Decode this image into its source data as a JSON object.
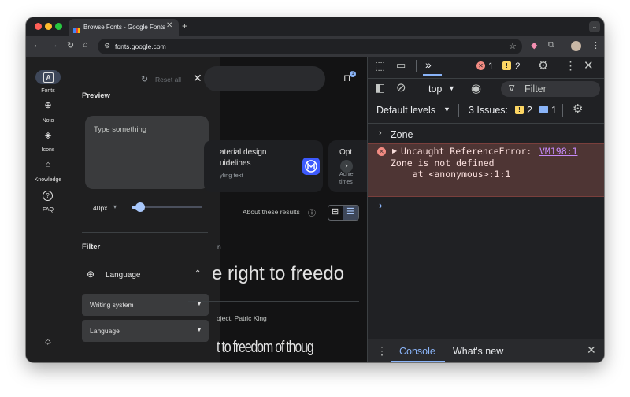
{
  "browser": {
    "tab_title": "Browse Fonts - Google Fonts",
    "url": "fonts.google.com",
    "new_tab_glyph": "+",
    "close_glyph": "✕"
  },
  "rail": {
    "items": [
      {
        "label": "Fonts",
        "icon": "font-icon",
        "glyph": "A"
      },
      {
        "label": "Noto",
        "icon": "globe-icon",
        "glyph": "⊕"
      },
      {
        "label": "Icons",
        "icon": "shapes-icon",
        "glyph": "◈"
      },
      {
        "label": "Knowledge",
        "icon": "school-icon",
        "glyph": "⌂"
      },
      {
        "label": "FAQ",
        "icon": "help-icon",
        "glyph": "?"
      }
    ]
  },
  "panel": {
    "reset_label": "Reset all",
    "preview_heading": "Preview",
    "textarea_placeholder": "Type something",
    "font_size_value": "40px",
    "font_size_level": 0.12,
    "filter_heading": "Filter",
    "language_heading": "Language",
    "writing_system_label": "Writing system",
    "language_select_label": "Language"
  },
  "content": {
    "card1_line1": "aterial design",
    "card1_line2": "uidelines",
    "card1_sub": "yling text",
    "card2_line1": "Opt",
    "card2_line2": "Achie",
    "card2_line3": "times",
    "about_results": "About these results",
    "breadcrumb_frag": "n",
    "sample_big": "e right to freedo",
    "designers": "oject, Patric King",
    "sample_condensed": "t to freedom of thoug",
    "bag_count": "1"
  },
  "devtools": {
    "error_count": "1",
    "warning_count": "2",
    "context_select": "top",
    "filter_placeholder": "Filter",
    "levels_label": "Default levels",
    "issues_label": "3 Issues:",
    "issues_warn_count": "2",
    "issues_info_count": "1",
    "console_lines": [
      {
        "text": "Zone"
      },
      {
        "title": "Uncaught ReferenceError:",
        "link": "VM198:1",
        "detail1": "Zone is not defined",
        "detail2": "    at <anonymous>:1:1"
      }
    ],
    "prompt_glyph": "›",
    "drawer_tabs": [
      "Console",
      "What's new"
    ]
  },
  "colors": {
    "error": "#f28b82",
    "warning": "#fdd663",
    "accent_blue": "#8ab4f8",
    "error_bg": "#4e3534"
  }
}
